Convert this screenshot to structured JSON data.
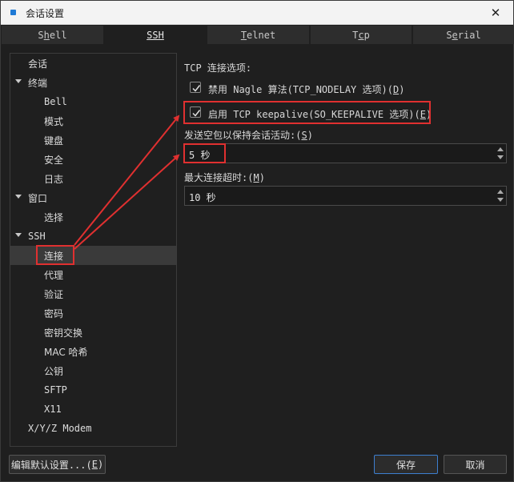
{
  "window": {
    "title": "会话设置",
    "accent": "#1e7ad6"
  },
  "tabs": [
    {
      "pre": "S",
      "ul": "h",
      "post": "ell"
    },
    {
      "pre": "",
      "ul": "SSH",
      "post": ""
    },
    {
      "pre": "",
      "ul": "T",
      "post": "elnet"
    },
    {
      "pre": "T",
      "ul": "c",
      "post": "p"
    },
    {
      "pre": "S",
      "ul": "e",
      "post": "rial"
    }
  ],
  "tree": {
    "items": [
      {
        "label": "会话"
      },
      {
        "label": "终端"
      },
      {
        "label": "Bell"
      },
      {
        "label": "模式"
      },
      {
        "label": "键盘"
      },
      {
        "label": "安全"
      },
      {
        "label": "日志"
      },
      {
        "label": "窗口"
      },
      {
        "label": "选择"
      },
      {
        "label": "SSH"
      },
      {
        "label": "连接"
      },
      {
        "label": "代理"
      },
      {
        "label": "验证"
      },
      {
        "label": "密码"
      },
      {
        "label": "密钥交换"
      },
      {
        "label": "MAC 哈希"
      },
      {
        "label": "公钥"
      },
      {
        "label": "SFTP"
      },
      {
        "label": "X11"
      },
      {
        "label": "X/Y/Z Modem"
      }
    ]
  },
  "panel": {
    "section_label": "TCP 连接选项:",
    "nagle": {
      "text": "禁用 Nagle 算法(TCP_NODELAY 选项)(",
      "key": "D",
      "end": ")",
      "checked": true
    },
    "keepalive": {
      "text": "启用 TCP keepalive(SO_KEEPALIVE 选项)(",
      "key": "E",
      "end": ")",
      "checked": true
    },
    "keepalive_interval": {
      "label": "发送空包以保持会话活动:(",
      "key": "S",
      "end": ")",
      "value": "5 秒"
    },
    "timeout": {
      "label": "最大连接超时:(",
      "key": "M",
      "end": ")",
      "value": "10 秒"
    }
  },
  "buttons": {
    "edit_default": {
      "text": "编辑默认设置...(",
      "key": "E",
      "end": ")"
    },
    "save": "保存",
    "cancel": "取消"
  },
  "annotation_color": "#e03030"
}
